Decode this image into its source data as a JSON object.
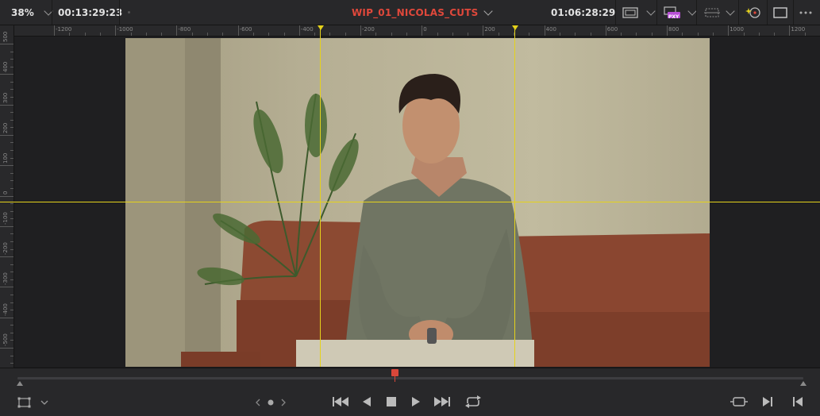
{
  "top_bar": {
    "zoom": "38%",
    "source_timecode": "00:13:29:23",
    "timeline_title": "WIP_01_NICOLAS_CUTS",
    "record_timecode": "01:06:28:29",
    "proxy_badge": "PXY"
  },
  "rulers": {
    "horizontal_labels": [
      "-1200",
      "-1000",
      "-800",
      "-600",
      "-400",
      "-200",
      "0",
      "200",
      "400",
      "600",
      "800",
      "1000",
      "1200"
    ],
    "vertical_labels": [
      "500",
      "400",
      "300",
      "200",
      "100",
      "0",
      "-100",
      "-200",
      "-300",
      "-400",
      "-500"
    ]
  },
  "viewer": {
    "image_description_icon": "interview-frame",
    "guide_color": "#e5d21b"
  },
  "transport": {
    "icons": [
      "transform-icon",
      "chevron-left-icon",
      "dot-icon",
      "chevron-right-icon",
      "skip-to-start-icon",
      "play-reverse-icon",
      "stop-icon",
      "play-icon",
      "skip-to-end-icon",
      "loop-icon",
      "match-frame-icon",
      "next-edit-icon",
      "previous-edit-icon"
    ]
  },
  "colors": {
    "accent": "#e0483b",
    "guide": "#e5d21b",
    "playhead": "#d9473a"
  }
}
